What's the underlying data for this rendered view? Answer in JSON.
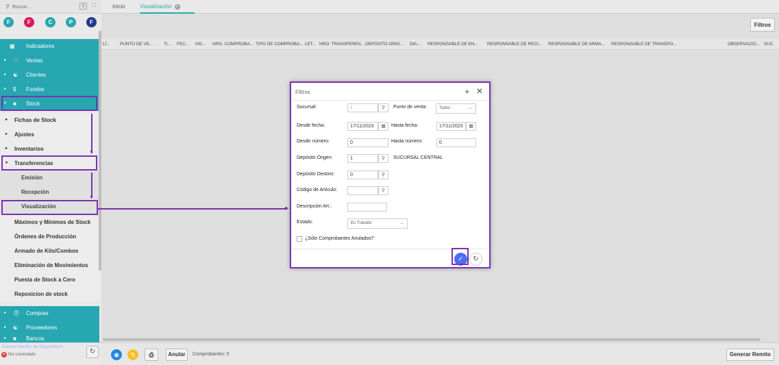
{
  "colors": {
    "accent": "#26a7b1",
    "highlight": "#7b2fb1",
    "confirm": "#4c6ef5"
  },
  "sidebar": {
    "search_placeholder": "Buscar...",
    "quick": [
      {
        "letter": "F",
        "color": "#26a7b1"
      },
      {
        "letter": "F",
        "color": "#d81b60"
      },
      {
        "letter": "C",
        "color": "#26a7b1"
      },
      {
        "letter": "P",
        "color": "#26a7b1"
      },
      {
        "letter": "F",
        "color": "#1e3a8a"
      }
    ],
    "top_items": [
      {
        "label": "Indicadores",
        "icon": "chart-icon"
      },
      {
        "label": "Ventas",
        "icon": "cart-icon"
      },
      {
        "label": "Clientes",
        "icon": "users-icon"
      },
      {
        "label": "Fondos",
        "icon": "dollar-icon"
      },
      {
        "label": "Stock",
        "icon": "box-icon"
      }
    ],
    "stock_children": [
      "Fichas de Stock",
      "Ajustes",
      "Inventarios",
      "Transferencias"
    ],
    "transfer_children": [
      "Emisión",
      "Recepción",
      "Visualización"
    ],
    "stock_more": [
      "Máximos y Mínimos de Stock",
      "Órdenes de Producción",
      "Armado de Kits/Combos",
      "Eliminación de Movimientos",
      "Puesta de Stock a Cero",
      "Reposicion de stock"
    ],
    "bottom_items": [
      {
        "label": "Compras",
        "icon": "basket-icon"
      },
      {
        "label": "Proveedores",
        "icon": "users-icon"
      },
      {
        "label": "Bancos",
        "icon": "bank-icon"
      }
    ],
    "device_link": "Enlace Interfaz de Dispositivos",
    "device_status": "No conectado"
  },
  "tabs": [
    "Inicio",
    "Visualización"
  ],
  "toolbar": {
    "filtros": "Filtros"
  },
  "columns": [
    "LÍ...",
    "PUNTO DE VE...",
    "TI...",
    "FEC...",
    "HO...",
    "NRO. COMPROBA...",
    "TIPO DE COMPROBA...",
    "LET...",
    "NRO. TRANSFEREN...",
    "DEPÓSITO ORIG...",
    "DIA...",
    "RESPONSABLE DE EN...",
    "RESPONSABLE DE RECI...",
    "RESPONSABLE DE ARMA...",
    "RESPONSABLE DE TRANSPO...",
    "OBSERVACIO...",
    "SUC"
  ],
  "bottom": {
    "anular": "Anular",
    "comprobantes": "Comprobantes: 0",
    "generar": "Generar Remito"
  },
  "modal": {
    "title": "Filtros",
    "sucursal_label": "Sucursal:",
    "sucursal_value": "1",
    "punto_label": "Punto de venta:",
    "punto_value": "Todos",
    "desde_fecha_label": "Desde fecha:",
    "desde_fecha": "17/11/2023",
    "hasta_fecha_label": "Hasta fecha:",
    "hasta_fecha": "17/11/2023",
    "desde_num_label": "Desde número:",
    "desde_num": "0",
    "hasta_num_label": "Hasta número:",
    "hasta_num": "0",
    "dep_origen_label": "Depósito Origen:",
    "dep_origen": "1",
    "dep_origen_name": "SUCURSAL CENTRAL",
    "dep_destino_label": "Depósito Destino:",
    "dep_destino": "0",
    "codigo_label": "Código de Artículo:",
    "desc_label": "Descripción Art.:",
    "estado_label": "Estado:",
    "estado_value": "En Tránsito",
    "anulados_label": "¿Sólo Comprobantes Anulados?"
  }
}
